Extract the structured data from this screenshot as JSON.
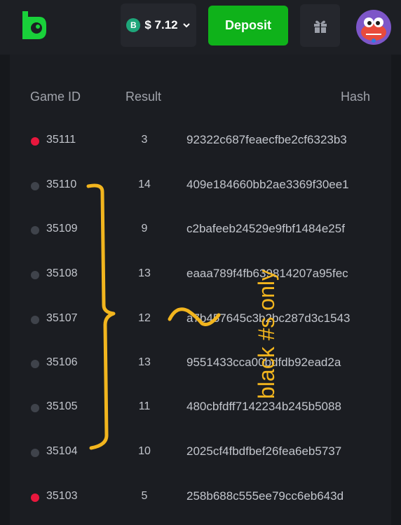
{
  "header": {
    "balance": "$ 7.12",
    "coin_letter": "B",
    "deposit_label": "Deposit"
  },
  "table": {
    "headers": {
      "game_id": "Game ID",
      "result": "Result",
      "hash": "Hash"
    },
    "rows": [
      {
        "id": "35111",
        "result": "3",
        "hash": "92322c687feaecfbe2cf6323b3",
        "color": "red"
      },
      {
        "id": "35110",
        "result": "14",
        "hash": "409e184660bb2ae3369f30ee1",
        "color": "black"
      },
      {
        "id": "35109",
        "result": "9",
        "hash": "c2bafeeb24529e9fbf1484e25f",
        "color": "black"
      },
      {
        "id": "35108",
        "result": "13",
        "hash": "eaaa789f4fb639814207a95fec",
        "color": "black"
      },
      {
        "id": "35107",
        "result": "12",
        "hash": "a7b457645c3b2bc287d3c1543",
        "color": "black"
      },
      {
        "id": "35106",
        "result": "13",
        "hash": "9551433cca00bdfdb92ead2a",
        "color": "black"
      },
      {
        "id": "35105",
        "result": "11",
        "hash": "480cbfdff7142234b245b5088",
        "color": "black"
      },
      {
        "id": "35104",
        "result": "10",
        "hash": "2025cf4fbdfbef26fea6eb5737",
        "color": "black"
      },
      {
        "id": "35103",
        "result": "5",
        "hash": "258b688c555ee79cc6eb643d",
        "color": "red"
      }
    ]
  },
  "annotation": {
    "text": "black #s only",
    "color": "#f2b51e"
  },
  "colors": {
    "red": "#e8173d",
    "black": "#3f434b",
    "deposit": "#0fb21a",
    "brand": "#19d13a"
  }
}
